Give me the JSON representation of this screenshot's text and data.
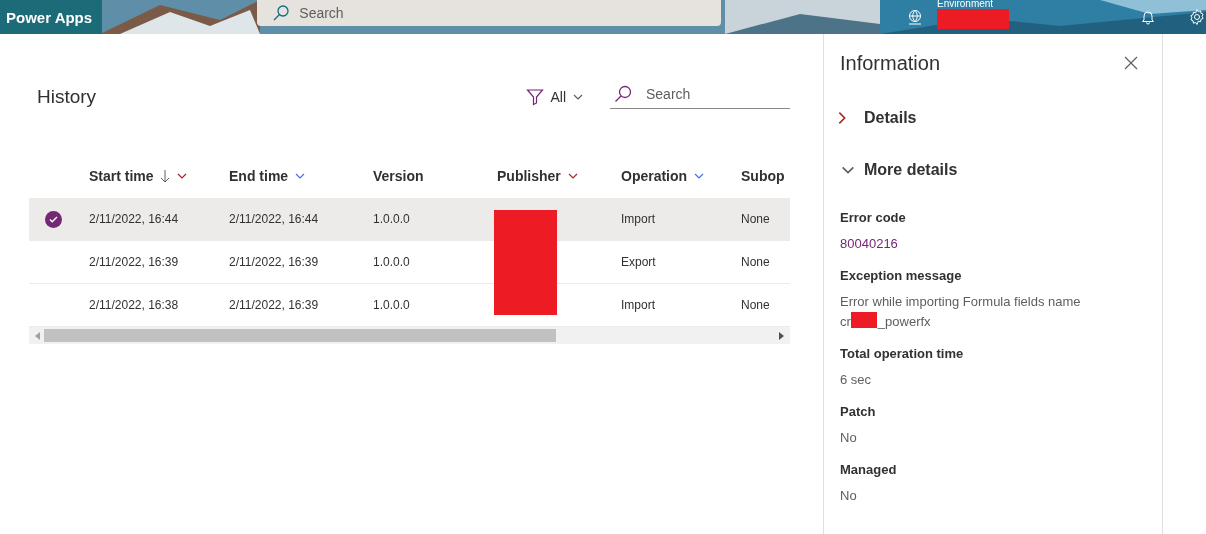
{
  "header": {
    "app_name": "Power Apps",
    "search": {
      "placeholder": "Search"
    },
    "environment": {
      "label": "Environment",
      "redacted": true
    }
  },
  "history": {
    "title": "History",
    "filter": {
      "label": "All"
    },
    "search": {
      "placeholder": "Search"
    },
    "table": {
      "publisher_redacted": true,
      "columns": [
        {
          "label": "Start time",
          "sorted": true,
          "menu": true
        },
        {
          "label": "End time",
          "sorted": false,
          "menu": true
        },
        {
          "label": "Version",
          "sorted": false,
          "menu": false
        },
        {
          "label": "Publisher",
          "sorted": false,
          "menu": true
        },
        {
          "label": "Operation",
          "sorted": false,
          "menu": true
        },
        {
          "label": "Subop"
        }
      ],
      "rows": [
        {
          "selected": true,
          "start": "2/11/2022, 16:44",
          "end": "2/11/2022, 16:44",
          "version": "1.0.0.0",
          "operation": "Import",
          "suboperation": "None"
        },
        {
          "selected": false,
          "start": "2/11/2022, 16:39",
          "end": "2/11/2022, 16:39",
          "version": "1.0.0.0",
          "operation": "Export",
          "suboperation": "None"
        },
        {
          "selected": false,
          "start": "2/11/2022, 16:38",
          "end": "2/11/2022, 16:39",
          "version": "1.0.0.0",
          "operation": "Import",
          "suboperation": "None"
        }
      ]
    }
  },
  "panel": {
    "title": "Information",
    "sections": [
      {
        "label": "Details",
        "expanded": false
      },
      {
        "label": "More details",
        "expanded": true
      }
    ],
    "fields": [
      {
        "label": "Error code",
        "value": "80040216",
        "kind": "code"
      },
      {
        "label": "Exception message",
        "value": "Error while importing Formula fields name",
        "value_before_redaction": "cr",
        "value_after_redaction": "_powerfx",
        "kind": "redacted"
      },
      {
        "label": "Total operation time",
        "value": "6 sec",
        "kind": "text"
      },
      {
        "label": "Patch",
        "value": "No",
        "kind": "text"
      },
      {
        "label": "Managed",
        "value": "No",
        "kind": "text"
      }
    ]
  }
}
